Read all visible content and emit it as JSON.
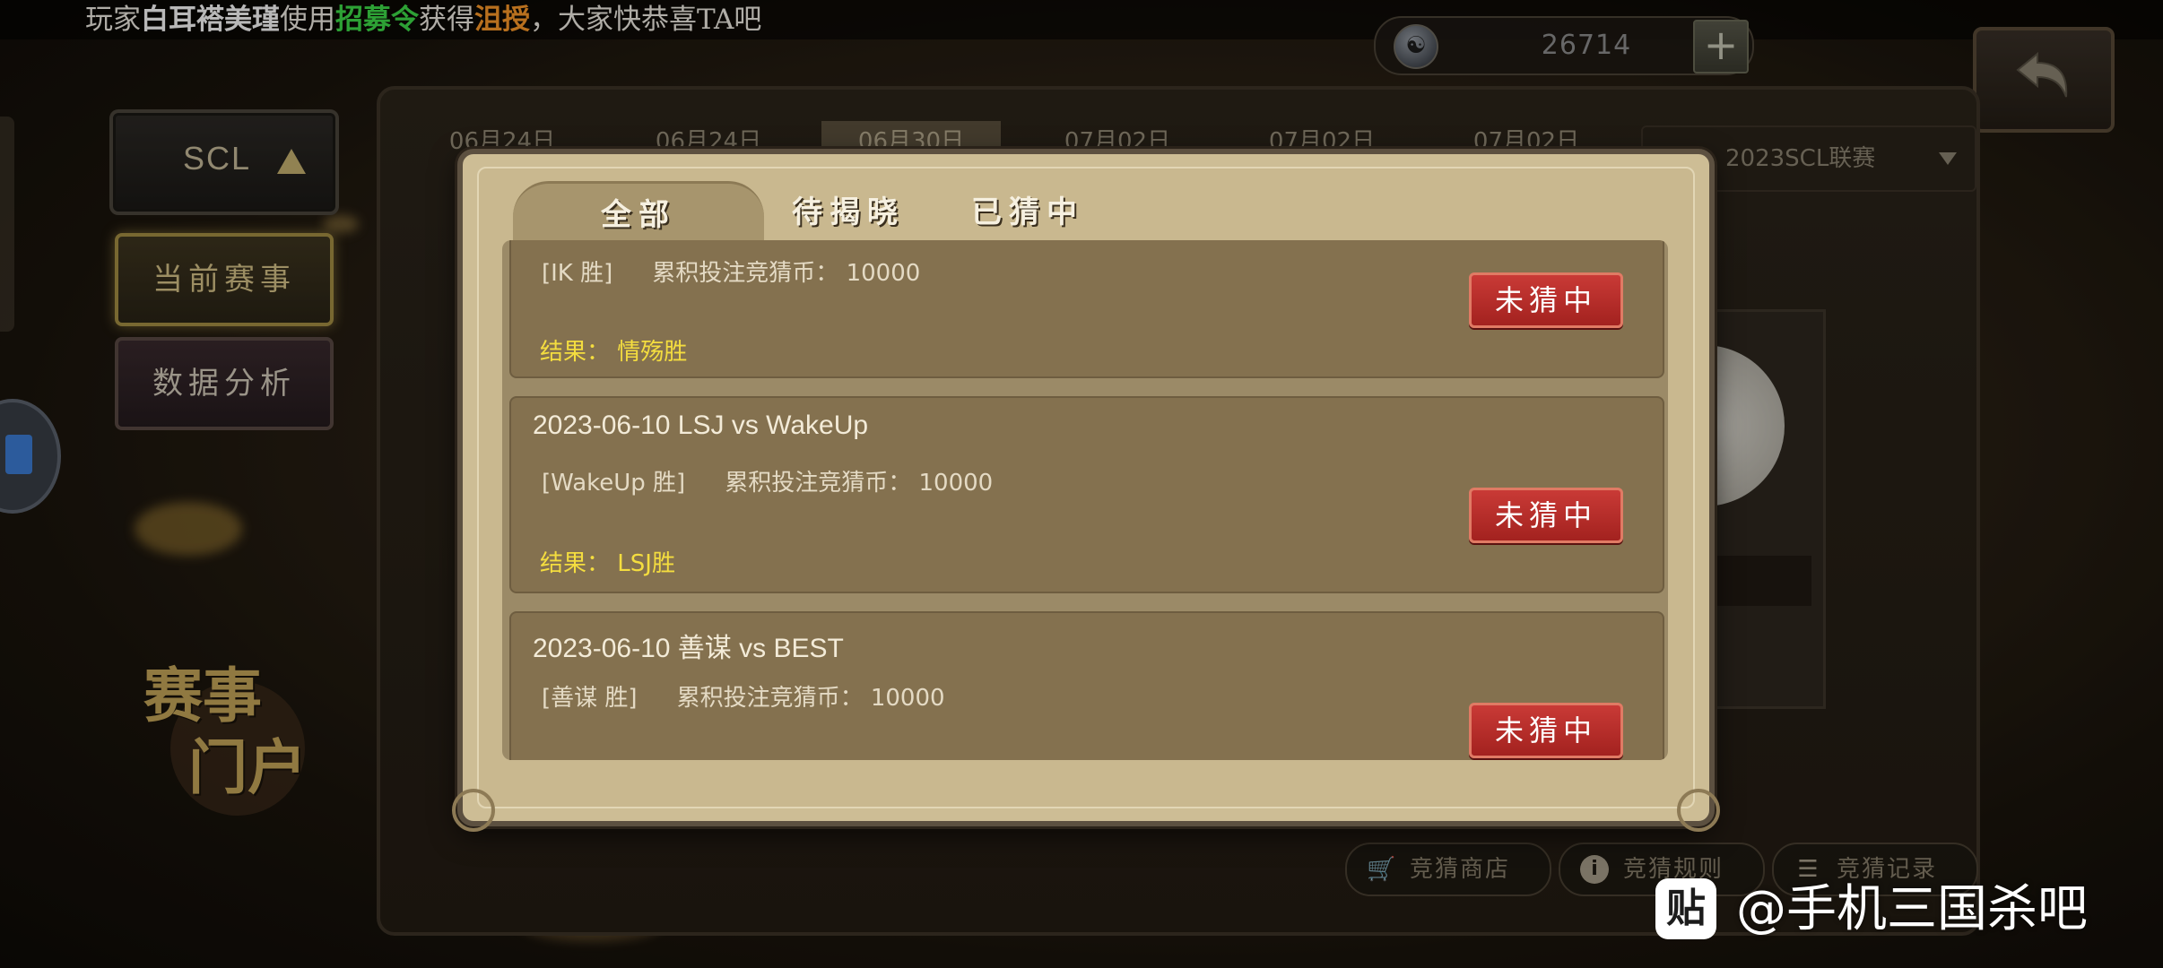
{
  "broadcast": {
    "prefix": "玩家",
    "player": "白耳褡美瑾",
    "verb": "使用",
    "item": "招募令",
    "obtained": "获得",
    "reward": "沮授",
    "suffix": "，大家快恭喜TA吧"
  },
  "currency": {
    "amount": "26714",
    "icon": "coin-icon",
    "add_label": "+"
  },
  "sidebar": {
    "scl_label": "SCL",
    "tabs": [
      {
        "label": "当前赛事",
        "active": true
      },
      {
        "label": "数据分析",
        "active": false
      }
    ],
    "portal_logo_line1": "赛事",
    "portal_logo_line2": "门户"
  },
  "background": {
    "dates": [
      "06月24日",
      "06月24日",
      "06月30日",
      "07月02日",
      "07月02日",
      "07月02日"
    ],
    "active_date_index": 2,
    "season": "2023SCL联赛",
    "bottom_buttons": [
      {
        "label": "竞猜商店",
        "icon": "cart-icon"
      },
      {
        "label": "竞猜规则",
        "icon": "info-icon"
      },
      {
        "label": "竞猜记录",
        "icon": "list-icon"
      }
    ]
  },
  "modal": {
    "tabs": [
      "全部",
      "待揭晓",
      "已猜中"
    ],
    "active_tab": "全部",
    "bet_label": "累积投注竞猜币：",
    "result_label": "结果：",
    "records": [
      {
        "match": "",
        "pick": "[IK 胜]",
        "amount": "10000",
        "result": "情殇胜",
        "status": "未猜中"
      },
      {
        "match": "2023-06-10   LSJ vs WakeUp",
        "pick": "[WakeUp 胜]",
        "amount": "10000",
        "result": "LSJ胜",
        "status": "未猜中"
      },
      {
        "match": "2023-06-10   善谋 vs BEST",
        "pick": "[善谋 胜]",
        "amount": "10000",
        "result": "",
        "status": "未猜中"
      }
    ]
  },
  "watermark": {
    "icon_text": "贴",
    "text": "@手机三国杀吧"
  },
  "colors": {
    "badge_red": "#b12c28",
    "result_yellow": "#f4dd3f",
    "card_brown": "#84714f",
    "modal_parchment": "#cdbd95"
  }
}
